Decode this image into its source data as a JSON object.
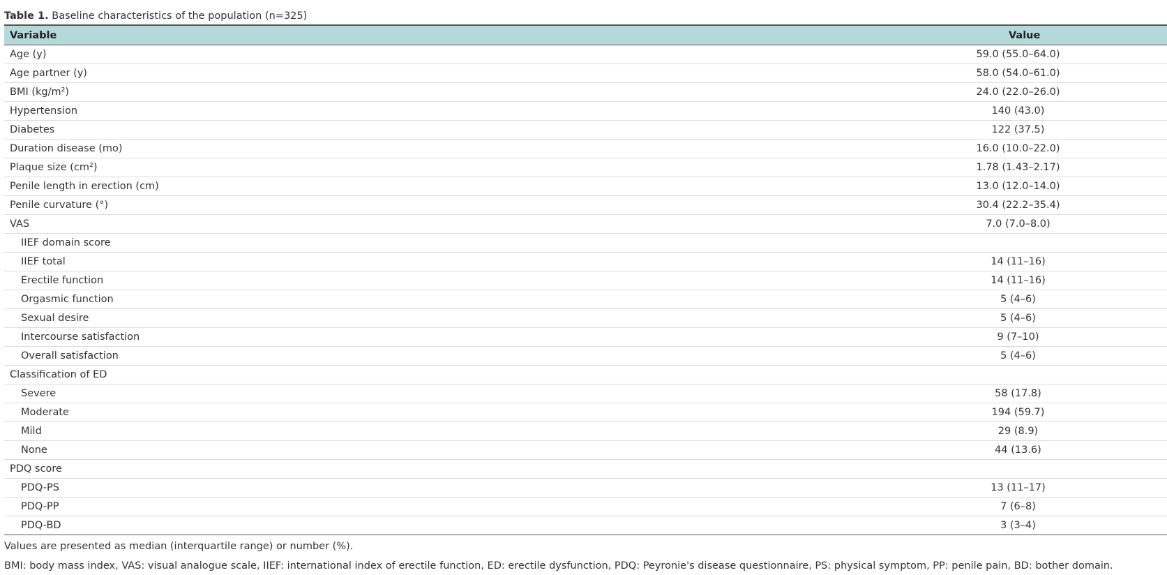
{
  "caption": {
    "label": "Table 1.",
    "text": "Baseline characteristics of the population (n=325)"
  },
  "table": {
    "headers": [
      "Variable",
      "Value"
    ],
    "rows": [
      {
        "variable": "Age (y)",
        "value": "59.0 (55.0–64.0)",
        "indent": false
      },
      {
        "variable": "Age partner (y)",
        "value": "58.0 (54.0–61.0)",
        "indent": false
      },
      {
        "variable": "BMI (kg/m²)",
        "value": "24.0 (22.0–26.0)",
        "indent": false
      },
      {
        "variable": "Hypertension",
        "value": "140 (43.0)",
        "indent": false
      },
      {
        "variable": "Diabetes",
        "value": "122 (37.5)",
        "indent": false
      },
      {
        "variable": "Duration disease (mo)",
        "value": "16.0 (10.0–22.0)",
        "indent": false
      },
      {
        "variable": "Plaque size (cm²)",
        "value": "1.78 (1.43–2.17)",
        "indent": false
      },
      {
        "variable": "Penile length in erection (cm)",
        "value": "13.0 (12.0–14.0)",
        "indent": false
      },
      {
        "variable": "Penile curvature (°)",
        "value": "30.4 (22.2–35.4)",
        "indent": false
      },
      {
        "variable": "VAS",
        "value": "7.0 (7.0–8.0)",
        "indent": false
      },
      {
        "variable": "IIEF domain score",
        "value": "",
        "indent": true
      },
      {
        "variable": "IIEF total",
        "value": "14 (11–16)",
        "indent": true
      },
      {
        "variable": "Erectile function",
        "value": "14 (11–16)",
        "indent": true
      },
      {
        "variable": "Orgasmic function",
        "value": "5 (4–6)",
        "indent": true
      },
      {
        "variable": "Sexual desire",
        "value": "5 (4–6)",
        "indent": true
      },
      {
        "variable": "Intercourse satisfaction",
        "value": "9 (7–10)",
        "indent": true
      },
      {
        "variable": "Overall satisfaction",
        "value": "5 (4–6)",
        "indent": true
      },
      {
        "variable": "Classification of ED",
        "value": "",
        "indent": false
      },
      {
        "variable": "Severe",
        "value": "58 (17.8)",
        "indent": true
      },
      {
        "variable": "Moderate",
        "value": "194 (59.7)",
        "indent": true
      },
      {
        "variable": "Mild",
        "value": "29 (8.9)",
        "indent": true
      },
      {
        "variable": "None",
        "value": "44 (13.6)",
        "indent": true
      },
      {
        "variable": "PDQ score",
        "value": "",
        "indent": false
      },
      {
        "variable": "PDQ-PS",
        "value": "13 (11–17)",
        "indent": true
      },
      {
        "variable": "PDQ-PP",
        "value": "7 (6–8)",
        "indent": true
      },
      {
        "variable": "PDQ-BD",
        "value": "3 (3–4)",
        "indent": true
      }
    ]
  },
  "footnotes": [
    "Values are presented as median (interquartile range) or number (%).",
    "BMI: body mass index, VAS: visual analogue scale, IIEF: international index of erectile function, ED: erectile dysfunction, PDQ: Peyronie's disease questionnaire, PS: physical symptom, PP: penile pain, BD: bother domain."
  ],
  "colors": {
    "header_bg": "#b4d9d9",
    "rule": "#555555",
    "row_divider": "#dcdcdc",
    "text": "#333333"
  }
}
